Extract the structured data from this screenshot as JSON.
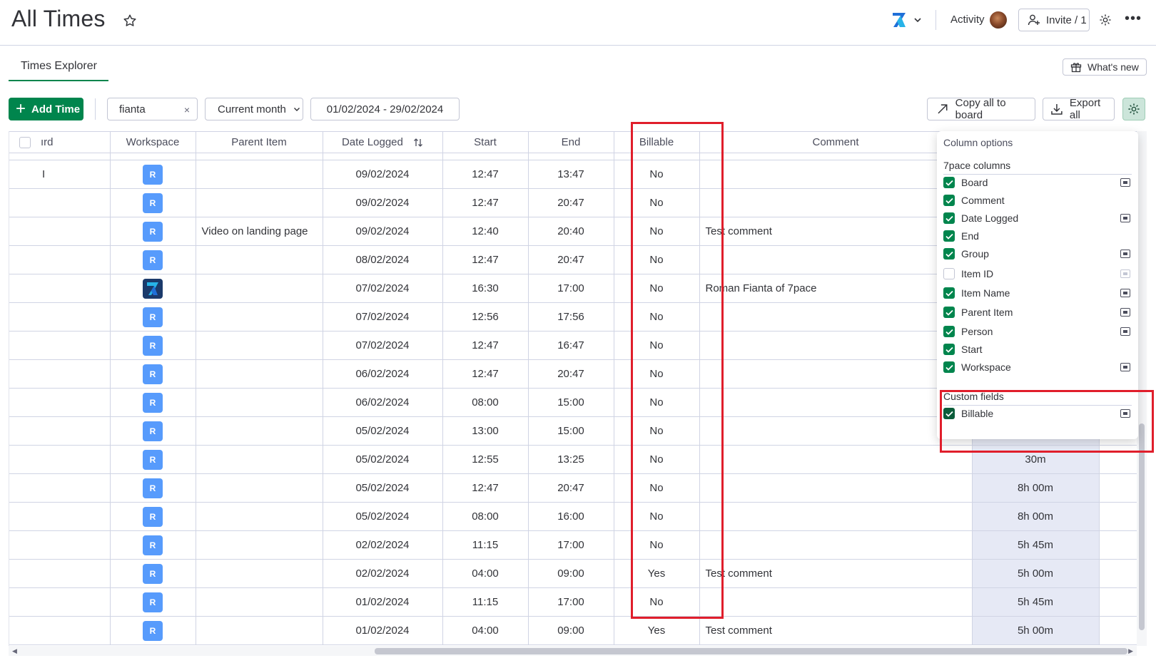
{
  "header": {
    "title": "All Times",
    "activity_label": "Activity",
    "invite_label": "Invite / 1",
    "more_glyph": "•••"
  },
  "tabs": [
    {
      "label": "Times Explorer"
    }
  ],
  "whats_new_label": "What's new",
  "toolbar": {
    "add_time_label": "Add Time",
    "search_value": "fianta",
    "clear_glyph": "×",
    "period_value": "Current month",
    "date_range_value": "01/02/2024 - 29/02/2024",
    "copy_board_label": "Copy all to board",
    "export_label": "Export all"
  },
  "table": {
    "columns": {
      "board": "ırd",
      "workspace": "Workspace",
      "parent_item": "Parent Item",
      "date_logged": "Date Logged",
      "start": "Start",
      "end": "End",
      "billable": "Billable",
      "comment": "Comment"
    },
    "rows": [
      {
        "board": "I",
        "ws": "R",
        "parent": "",
        "date": "09/02/2024",
        "start": "12:47",
        "end": "13:47",
        "billable": "No",
        "comment": "",
        "duration": ""
      },
      {
        "board": "",
        "ws": "R",
        "parent": "",
        "date": "09/02/2024",
        "start": "12:47",
        "end": "20:47",
        "billable": "No",
        "comment": "",
        "duration": ""
      },
      {
        "board": "",
        "ws": "R",
        "parent": "Video on landing page",
        "date": "09/02/2024",
        "start": "12:40",
        "end": "20:40",
        "billable": "No",
        "comment": "Test comment",
        "duration": ""
      },
      {
        "board": "",
        "ws": "R",
        "parent": "",
        "date": "08/02/2024",
        "start": "12:47",
        "end": "20:47",
        "billable": "No",
        "comment": "",
        "duration": ""
      },
      {
        "board": "",
        "ws": "",
        "parent": "",
        "date": "07/02/2024",
        "start": "16:30",
        "end": "17:00",
        "billable": "No",
        "comment": "Roman Fianta of 7pace",
        "duration": ""
      },
      {
        "board": "",
        "ws": "R",
        "parent": "",
        "date": "07/02/2024",
        "start": "12:56",
        "end": "17:56",
        "billable": "No",
        "comment": "",
        "duration": ""
      },
      {
        "board": "",
        "ws": "R",
        "parent": "",
        "date": "07/02/2024",
        "start": "12:47",
        "end": "16:47",
        "billable": "No",
        "comment": "",
        "duration": ""
      },
      {
        "board": "",
        "ws": "R",
        "parent": "",
        "date": "06/02/2024",
        "start": "12:47",
        "end": "20:47",
        "billable": "No",
        "comment": "",
        "duration": ""
      },
      {
        "board": "",
        "ws": "R",
        "parent": "",
        "date": "06/02/2024",
        "start": "08:00",
        "end": "15:00",
        "billable": "No",
        "comment": "",
        "duration": ""
      },
      {
        "board": "",
        "ws": "R",
        "parent": "",
        "date": "05/02/2024",
        "start": "13:00",
        "end": "15:00",
        "billable": "No",
        "comment": "",
        "duration": ""
      },
      {
        "board": "",
        "ws": "R",
        "parent": "",
        "date": "05/02/2024",
        "start": "12:55",
        "end": "13:25",
        "billable": "No",
        "comment": "",
        "duration": "30m"
      },
      {
        "board": "",
        "ws": "R",
        "parent": "",
        "date": "05/02/2024",
        "start": "12:47",
        "end": "20:47",
        "billable": "No",
        "comment": "",
        "duration": "8h 00m"
      },
      {
        "board": "",
        "ws": "R",
        "parent": "",
        "date": "05/02/2024",
        "start": "08:00",
        "end": "16:00",
        "billable": "No",
        "comment": "",
        "duration": "8h 00m"
      },
      {
        "board": "",
        "ws": "R",
        "parent": "",
        "date": "02/02/2024",
        "start": "11:15",
        "end": "17:00",
        "billable": "No",
        "comment": "",
        "duration": "5h 45m"
      },
      {
        "board": "",
        "ws": "R",
        "parent": "",
        "date": "02/02/2024",
        "start": "04:00",
        "end": "09:00",
        "billable": "Yes",
        "comment": "Test comment",
        "duration": "5h 00m"
      },
      {
        "board": "",
        "ws": "R",
        "parent": "",
        "date": "01/02/2024",
        "start": "11:15",
        "end": "17:00",
        "billable": "No",
        "comment": "",
        "duration": "5h 45m"
      },
      {
        "board": "",
        "ws": "R",
        "parent": "",
        "date": "01/02/2024",
        "start": "04:00",
        "end": "09:00",
        "billable": "Yes",
        "comment": "Test comment",
        "duration": "5h 00m"
      }
    ]
  },
  "column_options": {
    "title": "Column options",
    "section_7pace": "7pace columns",
    "items_7pace": [
      {
        "label": "Board",
        "checked": true,
        "pin": true
      },
      {
        "label": "Comment",
        "checked": true,
        "pin": false
      },
      {
        "label": "Date Logged",
        "checked": true,
        "pin": true
      },
      {
        "label": "End",
        "checked": true,
        "pin": false
      },
      {
        "label": "Group",
        "checked": true,
        "pin": true
      },
      {
        "label": "Item ID",
        "checked": false,
        "pin": true
      },
      {
        "label": "Item Name",
        "checked": true,
        "pin": true
      },
      {
        "label": "Parent Item",
        "checked": true,
        "pin": true
      },
      {
        "label": "Person",
        "checked": true,
        "pin": true
      },
      {
        "label": "Start",
        "checked": true,
        "pin": false
      },
      {
        "label": "Workspace",
        "checked": true,
        "pin": true
      }
    ],
    "section_custom": "Custom fields",
    "items_custom": [
      {
        "label": "Billable",
        "checked": true,
        "pin": true
      }
    ]
  },
  "colors": {
    "accent_green": "#00854d",
    "workspace_badge": "#579bfc",
    "highlight_red": "#e01e2b",
    "duration_bg": "#e6e9f5"
  }
}
